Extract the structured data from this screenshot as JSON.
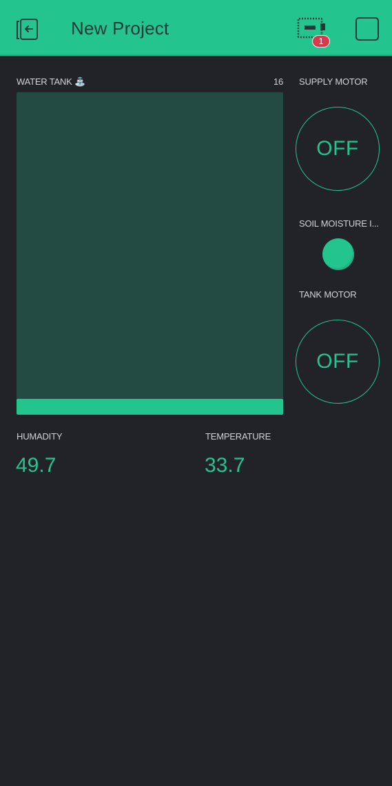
{
  "header": {
    "title": "New Project",
    "device_badge": "1",
    "back_icon": "exit-icon",
    "device_icon": "device-board-icon",
    "play_icon": "play-stop-square-icon"
  },
  "colors": {
    "accent": "#24c48e",
    "background": "#222328",
    "tank_empty": "#234b44",
    "badge": "#d63a4c"
  },
  "widgets": {
    "water_tank": {
      "label": "WATER TANK",
      "emoji": "⛲",
      "value": "16",
      "level_percent": 5
    },
    "supply_motor": {
      "label": "SUPPLY MOTOR",
      "state": "OFF"
    },
    "soil_moisture": {
      "label": "SOIL MOISTURE I..."
    },
    "tank_motor": {
      "label": "TANK MOTOR",
      "state": "OFF"
    },
    "humidity": {
      "label": "HUMADITY",
      "value": "49.7"
    },
    "temperature": {
      "label": "TEMPERATURE",
      "value": "33.7"
    }
  }
}
